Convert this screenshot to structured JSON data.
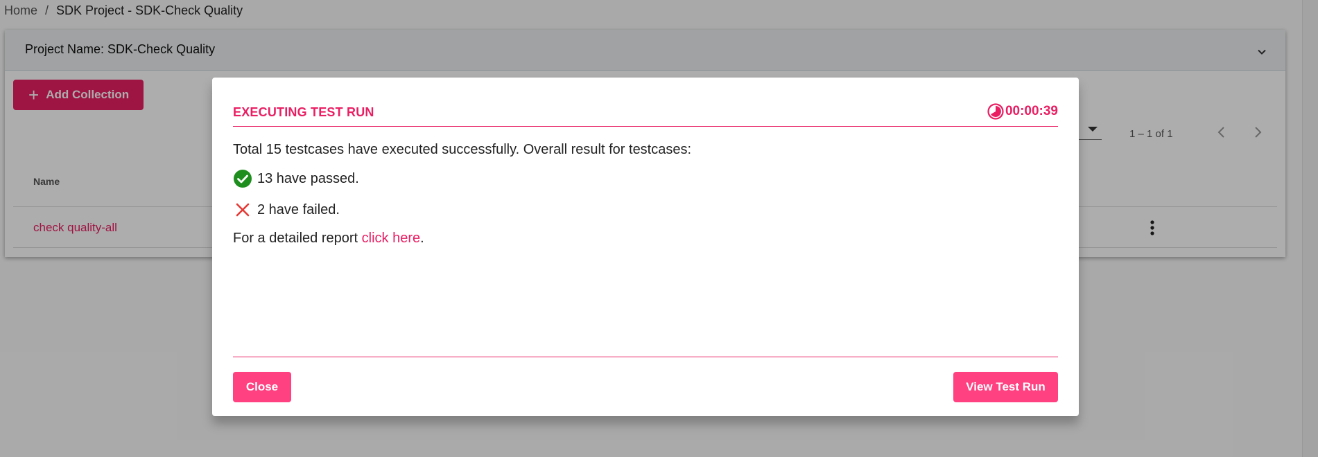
{
  "breadcrumb": {
    "home": "Home",
    "separator": "/",
    "current": "SDK Project - SDK-Check Quality"
  },
  "project": {
    "title": "Project Name: SDK-Check Quality",
    "add_button_label": "Add Collection",
    "paginator_range": "1 – 1 of 1",
    "table": {
      "columns": [
        "Name"
      ],
      "rows": [
        {
          "name": "check quality-all"
        }
      ]
    }
  },
  "dialog": {
    "title": "EXECUTING TEST RUN",
    "timer": "00:00:39",
    "summary": "Total 15 testcases have executed successfully. Overall result for testcases:",
    "passed_text": "13 have passed.",
    "failed_text": "2 have failed.",
    "report_prefix": "For a detailed report ",
    "report_link": "click here",
    "report_suffix": ".",
    "close_label": "Close",
    "view_label": "View Test Run"
  },
  "colors": {
    "accent": "#e91e63",
    "button": "#ff4081",
    "success": "#1e8e1e",
    "error": "#e53935"
  },
  "icons": {
    "timer": "timer-icon",
    "passed": "check-circle-icon",
    "failed": "close-x-icon",
    "add": "plus-icon",
    "expand": "chevron-down-icon",
    "more": "more-vertical-icon"
  }
}
